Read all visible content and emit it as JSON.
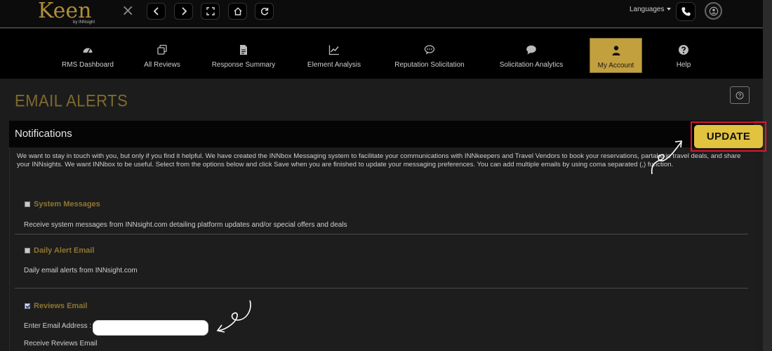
{
  "app": {
    "logo_text": "Keen",
    "logo_sub": "by INNsight"
  },
  "topbar": {
    "languages_label": "Languages",
    "buttons": [
      "back-icon",
      "forward-icon",
      "fullscreen-icon",
      "home-icon",
      "refresh-icon"
    ]
  },
  "nav": {
    "items": [
      {
        "label": "RMS Dashboard",
        "icon": "dashboard-icon"
      },
      {
        "label": "All Reviews",
        "icon": "reviews-icon"
      },
      {
        "label": "Response Summary",
        "icon": "document-icon"
      },
      {
        "label": "Element Analysis",
        "icon": "line-chart-icon"
      },
      {
        "label": "Reputation Solicitation",
        "icon": "chat-dots-icon"
      },
      {
        "label": "Solicitation Analytics",
        "icon": "chat-bubble-icon"
      },
      {
        "label": "My Account",
        "icon": "user-icon",
        "active": true
      },
      {
        "label": "Help",
        "icon": "question-icon"
      }
    ]
  },
  "page": {
    "title": "EMAIL ALERTS",
    "panel_title": "Notifications",
    "update_label": "UPDATE",
    "intro": "We want to stay in touch with you, but only if you find it helpful. We have created the INNbox Messaging system to facilitate your communications with INNkeepers and Travel Vendors to book your reservations, partake in travel deals, and share your INNsights. We want INNbox to be useful. Select from the options below and click Save when you are finished to update your messaging preferences. You can add multiple emails by using coma separated (,) function."
  },
  "options": [
    {
      "label": "System Messages",
      "checked": false,
      "description": "Receive system messages from INNsight.com detailing platform updates and/or special offers and deals"
    },
    {
      "label": "Daily Alert Email",
      "checked": false,
      "description": "Daily email alerts from INNsight.com"
    },
    {
      "label": "Reviews Email",
      "checked": true,
      "description": "Receive Reviews Email"
    }
  ],
  "email": {
    "label": "Enter Email Address :",
    "value": ""
  },
  "colors": {
    "accent_gold": "#c3a03e",
    "update_button": "#e1c33f",
    "highlight_red": "#e0162b",
    "label_gold": "#8d7532"
  }
}
